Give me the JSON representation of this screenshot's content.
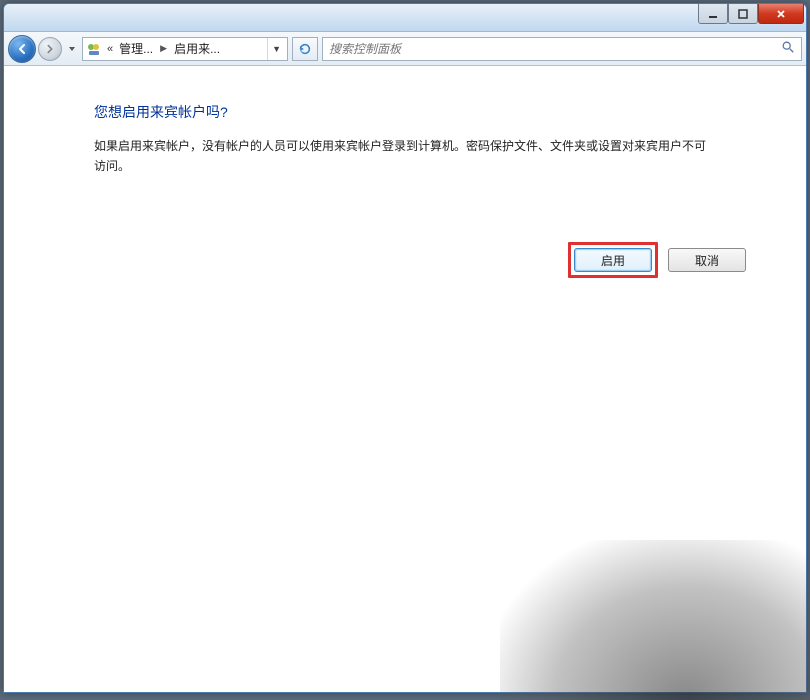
{
  "titlebar": {
    "minimize_tooltip": "最小化",
    "maximize_tooltip": "最大化",
    "close_tooltip": "关闭"
  },
  "nav": {
    "back_tooltip": "返回",
    "forward_tooltip": "前进",
    "refresh_tooltip": "刷新"
  },
  "breadcrumb": {
    "level0_prefix": "«",
    "level0": "管理...",
    "level1": "启用来..."
  },
  "search": {
    "placeholder": "搜索控制面板"
  },
  "main": {
    "heading": "您想启用来宾帐户吗?",
    "body": "如果启用来宾帐户，没有帐户的人员可以使用来宾帐户登录到计算机。密码保护文件、文件夹或设置对来宾用户不可访问。",
    "enable_label": "启用",
    "cancel_label": "取消"
  }
}
